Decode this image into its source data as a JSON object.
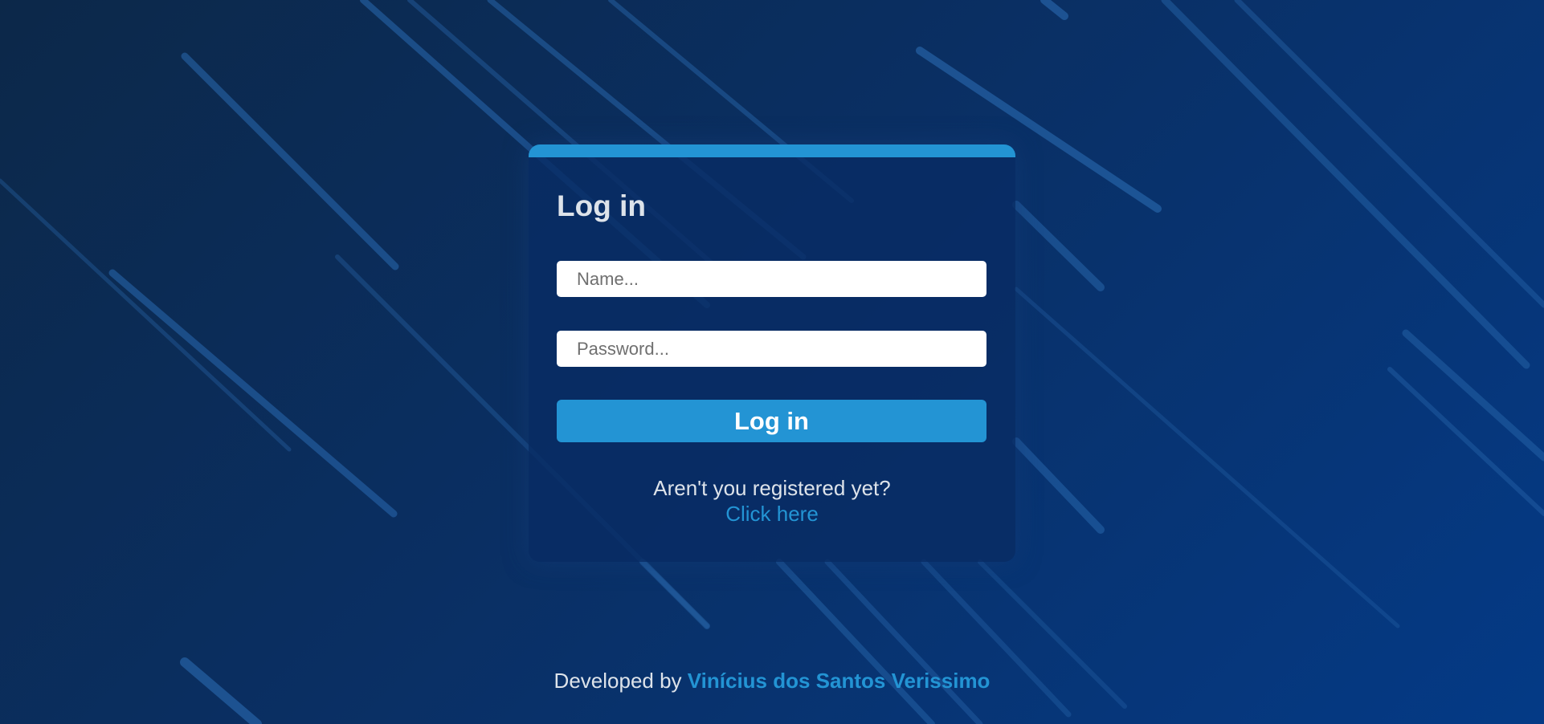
{
  "login": {
    "title": "Log in",
    "name_placeholder": "Name...",
    "password_placeholder": "Password...",
    "submit_label": "Log in",
    "register_prompt": "Aren't you registered yet?",
    "register_link": "Click here"
  },
  "footer": {
    "prefix": "Developed by",
    "author": "Vinícius dos Santos Verissimo"
  },
  "colors": {
    "accent": "#2394d4",
    "background_start": "#0c2849",
    "background_end": "#043a86"
  }
}
